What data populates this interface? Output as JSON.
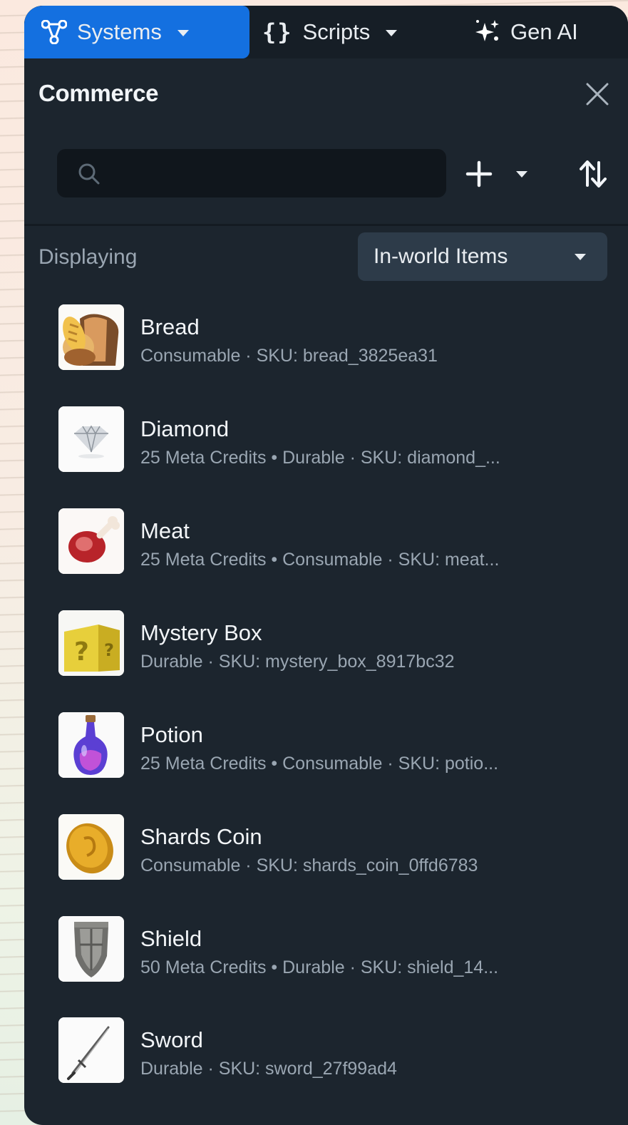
{
  "topbar": {
    "tabs": [
      {
        "label": "Systems",
        "icon": "systems-icon",
        "active": true
      },
      {
        "label": "Scripts",
        "icon": "braces-icon",
        "glyph": "{}"
      },
      {
        "label": "Gen AI",
        "icon": "sparkle-icon"
      }
    ]
  },
  "panel": {
    "title": "Commerce",
    "search": {
      "value": "",
      "placeholder": ""
    },
    "displaying_label": "Displaying",
    "filter": {
      "selected": "In-world Items"
    }
  },
  "items": [
    {
      "name": "Bread",
      "meta": "Consumable · SKU: bread_3825ea31",
      "icon": "bread-icon"
    },
    {
      "name": "Diamond",
      "meta": "25 Meta Credits • Durable · SKU: diamond_...",
      "icon": "diamond-icon"
    },
    {
      "name": "Meat",
      "meta": "25 Meta Credits • Consumable · SKU: meat...",
      "icon": "meat-icon"
    },
    {
      "name": "Mystery Box",
      "meta": "Durable · SKU: mystery_box_8917bc32",
      "icon": "mystery-box-icon"
    },
    {
      "name": "Potion",
      "meta": "25 Meta Credits • Consumable · SKU: potio...",
      "icon": "potion-icon"
    },
    {
      "name": "Shards Coin",
      "meta": "Consumable · SKU: shards_coin_0ffd6783",
      "icon": "coin-icon"
    },
    {
      "name": "Shield",
      "meta": "50 Meta Credits • Durable · SKU: shield_14...",
      "icon": "shield-icon"
    },
    {
      "name": "Sword",
      "meta": "Durable · SKU: sword_27f99ad4",
      "icon": "sword-icon"
    }
  ],
  "colors": {
    "panel_bg": "#1c252e",
    "active_tab": "#1470e0",
    "text_primary": "#f2f5f8",
    "text_secondary": "#9aa6b2"
  }
}
